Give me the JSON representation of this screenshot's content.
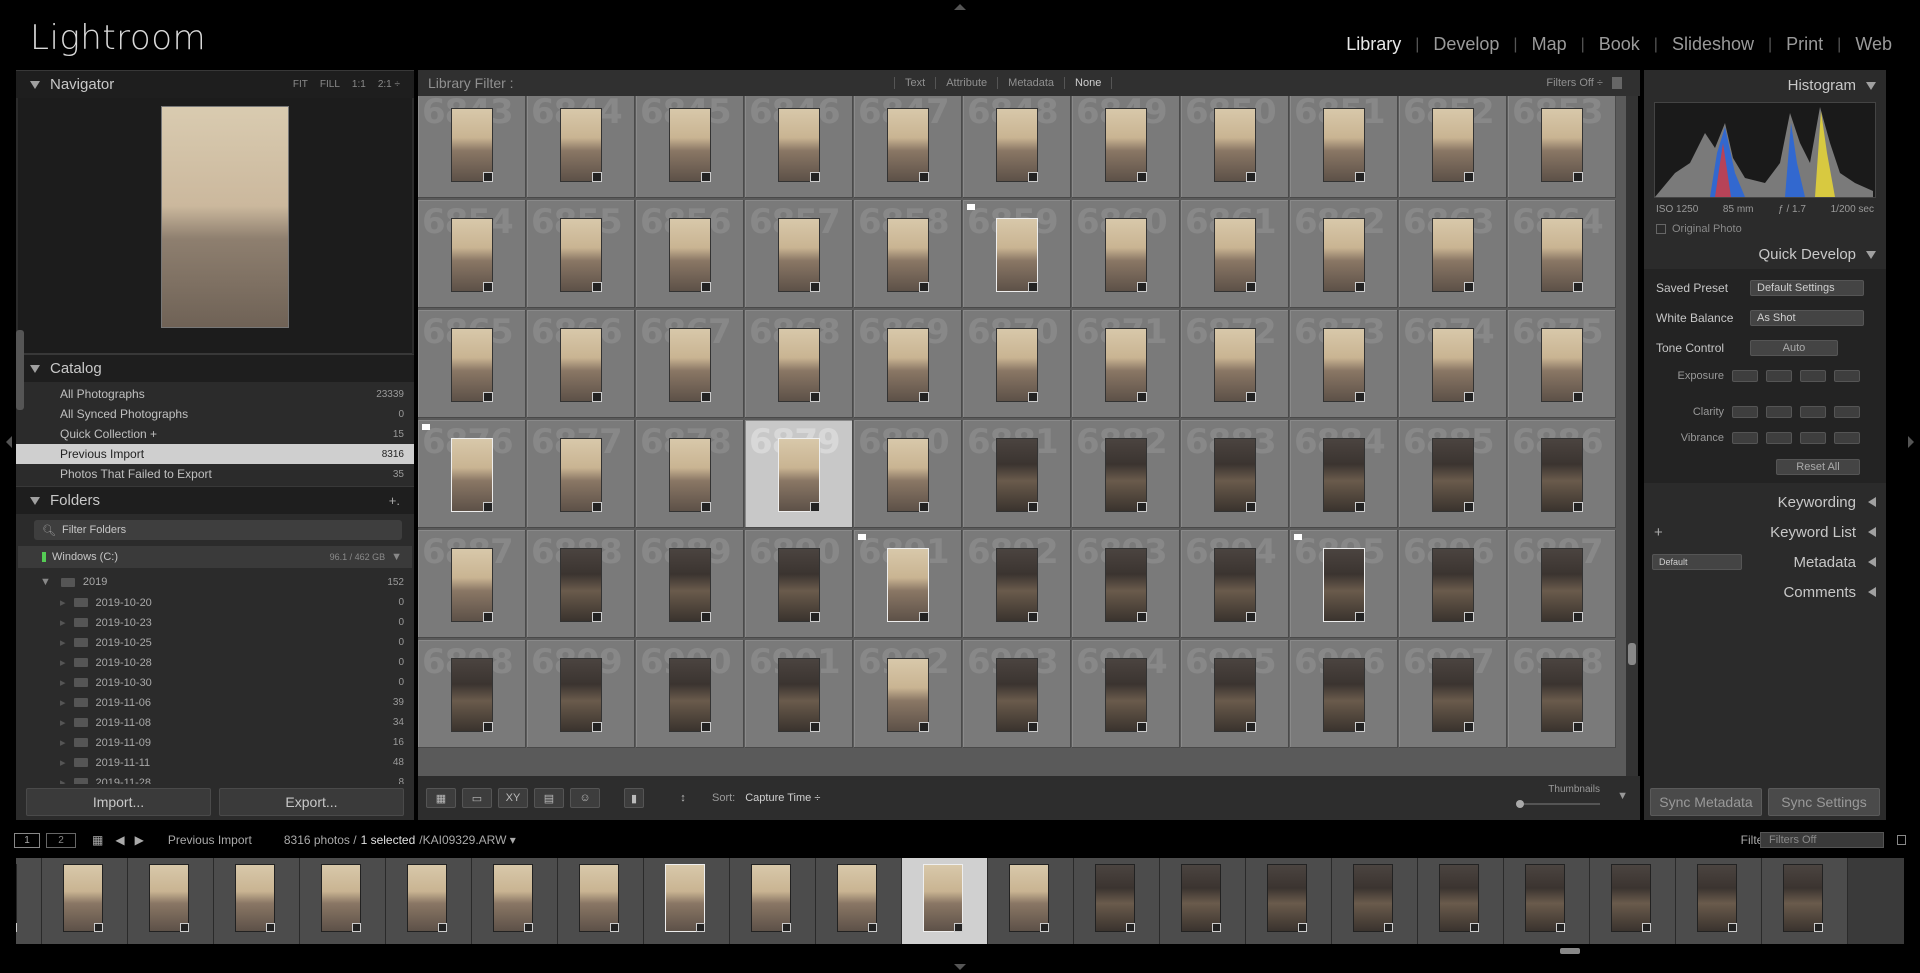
{
  "app": {
    "brand": "Lightroom",
    "modules": [
      "Library",
      "Develop",
      "Map",
      "Book",
      "Slideshow",
      "Print",
      "Web"
    ],
    "active_module": "Library"
  },
  "navigator": {
    "title": "Navigator",
    "options": [
      "FIT",
      "FILL",
      "1:1",
      "2:1 ÷"
    ]
  },
  "catalog": {
    "title": "Catalog",
    "items": [
      {
        "label": "All Photographs",
        "count": "23339"
      },
      {
        "label": "All Synced Photographs",
        "count": "0"
      },
      {
        "label": "Quick Collection +",
        "count": "15"
      },
      {
        "label": "Previous Import",
        "count": "8316"
      },
      {
        "label": "Photos That Failed to Export",
        "count": "35"
      }
    ],
    "selected_index": 3
  },
  "folders": {
    "title": "Folders",
    "add": "+.",
    "filter_placeholder": "Filter Folders",
    "volume": {
      "name": "Windows (C:)",
      "stat": "96.1 / 462 GB"
    },
    "year": {
      "label": "2019",
      "count": "152"
    },
    "items": [
      {
        "label": "2019-10-20",
        "count": "0"
      },
      {
        "label": "2019-10-23",
        "count": "0"
      },
      {
        "label": "2019-10-25",
        "count": "0"
      },
      {
        "label": "2019-10-28",
        "count": "0"
      },
      {
        "label": "2019-10-30",
        "count": "0"
      },
      {
        "label": "2019-11-06",
        "count": "39"
      },
      {
        "label": "2019-11-08",
        "count": "34"
      },
      {
        "label": "2019-11-09",
        "count": "16"
      },
      {
        "label": "2019-11-11",
        "count": "48"
      },
      {
        "label": "2019-11-28",
        "count": "8"
      }
    ]
  },
  "left_buttons": {
    "import": "Import...",
    "export": "Export..."
  },
  "filter_bar": {
    "title": "Library Filter :",
    "tabs": [
      "Text",
      "Attribute",
      "Metadata",
      "None"
    ],
    "active_tab": "None",
    "state": "Filters Off ÷"
  },
  "grid": {
    "rows": [
      [
        "6843",
        "6844",
        "6845",
        "6846",
        "6847",
        "6848",
        "6849",
        "6850",
        "6851",
        "6852",
        "6853"
      ],
      [
        "6854",
        "6855",
        "6856",
        "6857",
        "6858",
        "6859",
        "6860",
        "6861",
        "6862",
        "6863",
        "6864"
      ],
      [
        "6865",
        "6866",
        "6867",
        "6868",
        "6869",
        "6870",
        "6871",
        "6872",
        "6873",
        "6874",
        "6875"
      ],
      [
        "6876",
        "6877",
        "6878",
        "6879",
        "6880",
        "6881",
        "6882",
        "6883",
        "6884",
        "6885",
        "6886"
      ],
      [
        "6887",
        "6888",
        "6889",
        "6890",
        "6891",
        "6892",
        "6893",
        "6894",
        "6895",
        "6896",
        "6897"
      ],
      [
        "6898",
        "6899",
        "6900",
        "6901",
        "6902",
        "6903",
        "6904",
        "6905",
        "6906",
        "6907",
        "6908"
      ]
    ],
    "selected": "6879"
  },
  "toolbar": {
    "sort_label": "Sort:",
    "sort_value": "Capture Time ÷",
    "thumbnails_label": "Thumbnails"
  },
  "histogram": {
    "title": "Histogram",
    "iso": "ISO 1250",
    "focal": "85 mm",
    "aperture": "ƒ / 1.7",
    "shutter": "1/200 sec",
    "original_photo": "Original Photo"
  },
  "quick_develop": {
    "title": "Quick Develop",
    "saved_preset_label": "Saved Preset",
    "saved_preset_value": "Default Settings",
    "white_balance_label": "White Balance",
    "white_balance_value": "As Shot",
    "tone_control_label": "Tone Control",
    "auto": "Auto",
    "adjusts": [
      "Exposure",
      "Clarity",
      "Vibrance"
    ],
    "reset": "Reset All"
  },
  "right_panels": {
    "keywording": "Keywording",
    "keyword_list": "Keyword List",
    "metadata": "Metadata",
    "metadata_preset": "Default",
    "comments": "Comments"
  },
  "right_buttons": {
    "sync_metadata": "Sync Metadata",
    "sync_settings": "Sync Settings"
  },
  "filmstrip_bar": {
    "monitor1": "1",
    "monitor2": "2",
    "source": "Previous Import",
    "count_text": "8316 photos /",
    "selected_text": "1 selected",
    "file": "/KAI09329.ARW ▾",
    "filter_label": "Filter :",
    "filter_value": "Filters Off"
  }
}
